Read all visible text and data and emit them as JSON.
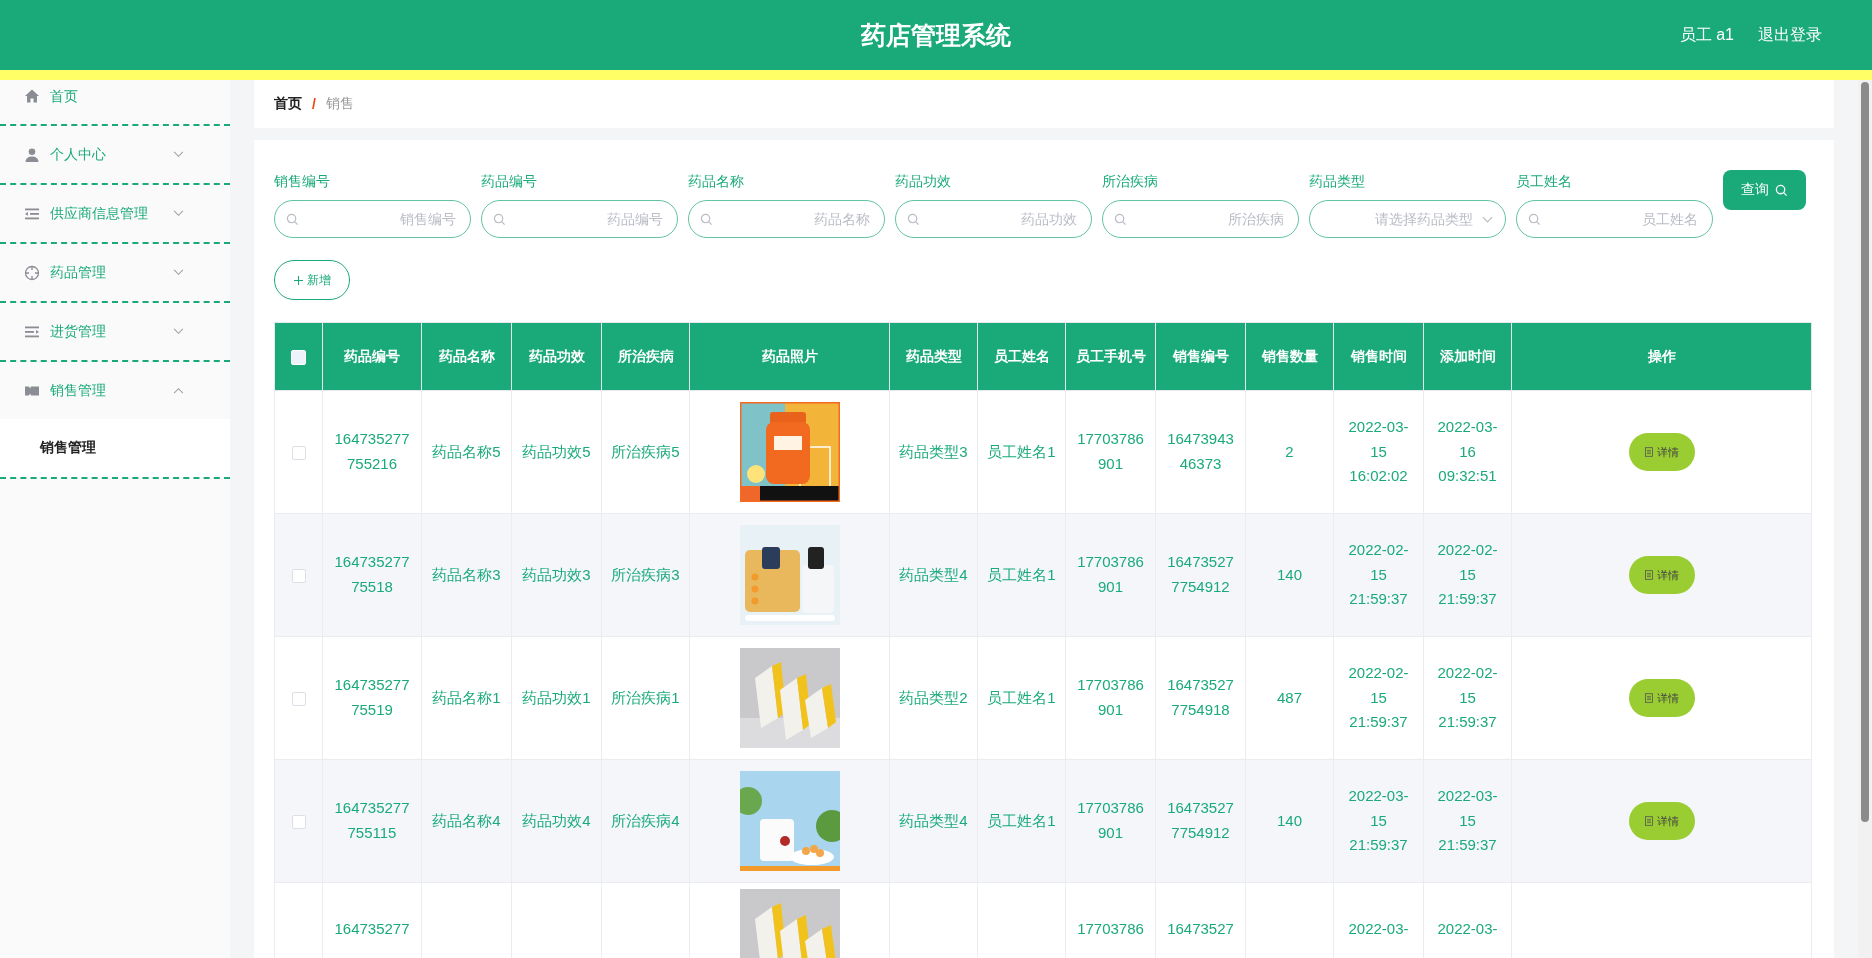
{
  "header": {
    "title": "药店管理系统",
    "user": "员工 a1",
    "logout": "退出登录"
  },
  "sidebar": {
    "items": [
      {
        "label": "首页",
        "kind": "link"
      },
      {
        "label": "个人中心",
        "kind": "submenu",
        "expanded": false
      },
      {
        "label": "供应商信息管理",
        "kind": "submenu",
        "expanded": false
      },
      {
        "label": "药品管理",
        "kind": "submenu",
        "expanded": false
      },
      {
        "label": "进货管理",
        "kind": "submenu",
        "expanded": false
      },
      {
        "label": "销售管理",
        "kind": "submenu",
        "expanded": true,
        "children": [
          {
            "label": "销售管理",
            "selected": true
          }
        ]
      }
    ]
  },
  "breadcrumb": {
    "items": [
      "首页",
      "销售"
    ],
    "separator": "/"
  },
  "search": {
    "fields": [
      {
        "label": "销售编号",
        "placeholder": "销售编号",
        "kind": "text"
      },
      {
        "label": "药品编号",
        "placeholder": "药品编号",
        "kind": "text"
      },
      {
        "label": "药品名称",
        "placeholder": "药品名称",
        "kind": "text"
      },
      {
        "label": "药品功效",
        "placeholder": "药品功效",
        "kind": "text"
      },
      {
        "label": "所治疾病",
        "placeholder": "所治疾病",
        "kind": "text"
      },
      {
        "label": "药品类型",
        "placeholder": "请选择药品类型",
        "kind": "select"
      },
      {
        "label": "员工姓名",
        "placeholder": "员工姓名",
        "kind": "text"
      }
    ],
    "query_button": "查询",
    "add_button": "新增"
  },
  "table": {
    "select_all": {
      "checked": false
    },
    "columns": [
      "药品编号",
      "药品名称",
      "药品功效",
      "所治疾病",
      "药品照片",
      "药品类型",
      "员工姓名",
      "员工手机号",
      "销售编号",
      "销售数量",
      "销售时间",
      "添加时间",
      "操作"
    ],
    "rows": [
      {
        "checked": false,
        "drug_code": "164735277755216",
        "drug_name": "药品名称5",
        "efficacy": "药品功效5",
        "disease": "所治疾病5",
        "drug_type": "药品类型3",
        "employee_name": "员工姓名1",
        "employee_phone": "17703786901",
        "sale_code": "1647394346373",
        "sale_qty": "2",
        "sale_time": "2022-03-15 16:02:02",
        "add_time": "2022-03-16 09:32:51",
        "action": "详情"
      },
      {
        "checked": false,
        "drug_code": "16473527775518",
        "drug_name": "药品名称3",
        "efficacy": "药品功效3",
        "disease": "所治疾病3",
        "drug_type": "药品类型4",
        "employee_name": "员工姓名1",
        "employee_phone": "17703786901",
        "sale_code": "164735277754912",
        "sale_qty": "140",
        "sale_time": "2022-02-15 21:59:37",
        "add_time": "2022-02-15 21:59:37",
        "action": "详情"
      },
      {
        "checked": false,
        "drug_code": "16473527775519",
        "drug_name": "药品名称1",
        "efficacy": "药品功效1",
        "disease": "所治疾病1",
        "drug_type": "药品类型2",
        "employee_name": "员工姓名1",
        "employee_phone": "17703786901",
        "sale_code": "164735277754918",
        "sale_qty": "487",
        "sale_time": "2022-02-15 21:59:37",
        "add_time": "2022-02-15 21:59:37",
        "action": "详情"
      },
      {
        "checked": false,
        "drug_code": "164735277755115",
        "drug_name": "药品名称4",
        "efficacy": "药品功效4",
        "disease": "所治疾病4",
        "drug_type": "药品类型4",
        "employee_name": "员工姓名1",
        "employee_phone": "17703786901",
        "sale_code": "164735277754912",
        "sale_qty": "140",
        "sale_time": "2022-03-15 21:59:37",
        "add_time": "2022-03-15 21:59:37",
        "action": "详情"
      },
      {
        "drug_code": "164735277",
        "employee_phone": "17703786",
        "sale_code": "16473527",
        "sale_time": "2022-03-",
        "add_time": "2022-03-"
      }
    ]
  }
}
